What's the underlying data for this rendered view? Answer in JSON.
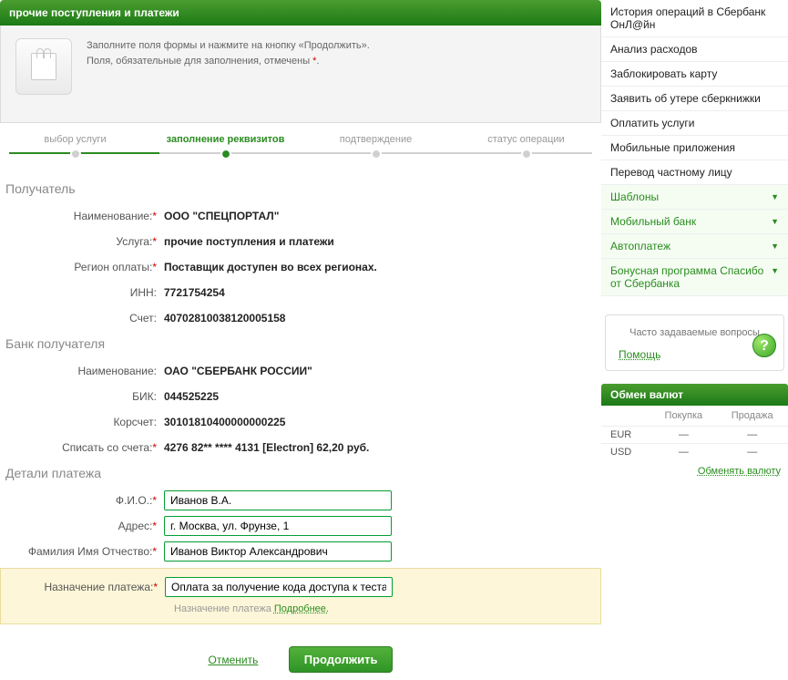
{
  "header": {
    "title": "прочие поступления и платежи"
  },
  "intro": {
    "line1_a": "Заполните поля формы и нажмите на кнопку «Продолжить».",
    "line2_a": "Поля, обязательные для заполнения, отмечены ",
    "line2_b": "."
  },
  "steps": {
    "s1": "выбор услуги",
    "s2": "заполнение реквизитов",
    "s3": "подтверждение",
    "s4": "статус операции"
  },
  "sections": {
    "receiver": "Получатель",
    "receiver_bank": "Банк получателя",
    "payment_details": "Детали платежа"
  },
  "labels": {
    "name": "Наименование:",
    "service": "Услуга:",
    "region": "Регион оплаты:",
    "inn": "ИНН:",
    "account": "Счет:",
    "bank_name": "Наименование:",
    "bik": "БИК:",
    "korr": "Корсчет:",
    "debit_from": "Списать со счета:",
    "fio": "Ф.И.О.:",
    "address": "Адрес:",
    "full_name": "Фамилия Имя Отчество:",
    "purpose": "Назначение платежа:"
  },
  "values": {
    "name": "ООО \"СПЕЦПОРТАЛ\"",
    "service": "прочие поступления и платежи",
    "region": "Поставщик доступен во всех регионах.",
    "inn": "7721754254",
    "account": "40702810038120005158",
    "bank_name": "ОАО \"СБЕРБАНК РОССИИ\"",
    "bik": "044525225",
    "korr": "30101810400000000225",
    "debit_from": "4276 82** **** 4131  [Electron] 62,20  руб."
  },
  "inputs": {
    "fio": "Иванов В.А.",
    "address": "г. Москва, ул. Фрунзе, 1",
    "full_name": "Иванов Виктор Александрович",
    "purpose": "Оплата за получение кода доступа к тестам"
  },
  "purpose_hint": {
    "text": "Назначение платежа ",
    "link": "Подробнее."
  },
  "actions": {
    "cancel": "Отменить",
    "continue": "Продолжить"
  },
  "sidebar": {
    "items": [
      "История операций в Сбербанк ОнЛ@йн",
      "Анализ расходов",
      "Заблокировать карту",
      "Заявить об утере сберкнижки",
      "Оплатить услуги",
      "Мобильные приложения",
      "Перевод частному лицу"
    ],
    "green_items": [
      "Шаблоны",
      "Мобильный банк",
      "Автоплатеж",
      "Бонусная программа Спасибо от Сбербанка"
    ]
  },
  "help": {
    "faq": "Часто задаваемые вопросы",
    "link": "Помощь"
  },
  "rates": {
    "title": "Обмен валют",
    "buy": "Покупка",
    "sell": "Продажа",
    "rows": [
      {
        "cur": "EUR",
        "buy": "—",
        "sell": "—"
      },
      {
        "cur": "USD",
        "buy": "—",
        "sell": "—"
      }
    ],
    "link": "Обменять валюту"
  }
}
